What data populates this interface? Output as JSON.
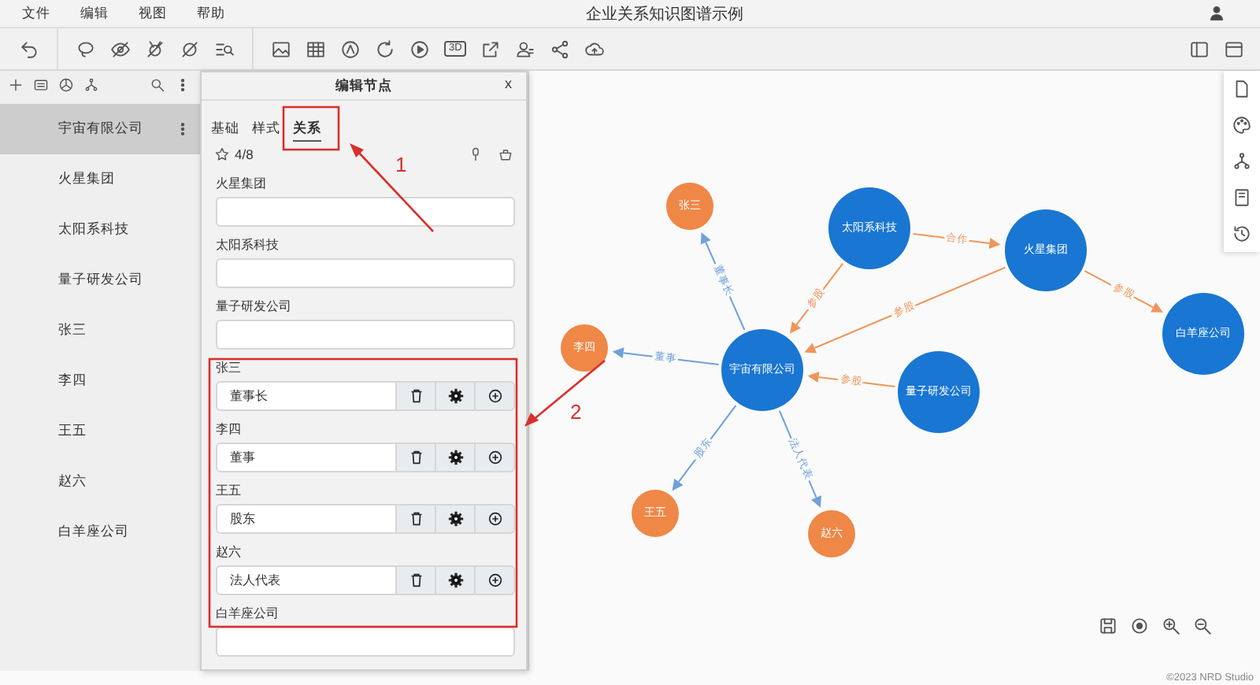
{
  "menu": [
    {
      "label": "文件"
    },
    {
      "label": "编辑"
    },
    {
      "label": "视图"
    },
    {
      "label": "帮助"
    }
  ],
  "window": {
    "title": "企业关系知识图谱示例"
  },
  "toolbar": {
    "three_d": "3D"
  },
  "sidebar": {
    "items": [
      {
        "label": "宇宙有限公司",
        "selected": true
      },
      {
        "label": "火星集团",
        "selected": false
      },
      {
        "label": "太阳系科技",
        "selected": false
      },
      {
        "label": "量子研发公司",
        "selected": false
      },
      {
        "label": "张三",
        "selected": false
      },
      {
        "label": "李四",
        "selected": false
      },
      {
        "label": "王五",
        "selected": false
      },
      {
        "label": "赵六",
        "selected": false
      },
      {
        "label": "白羊座公司",
        "selected": false
      }
    ]
  },
  "editor": {
    "title": "编辑节点",
    "close": "x",
    "tabs": [
      {
        "label": "基础",
        "selected": false
      },
      {
        "label": "样式",
        "selected": false
      },
      {
        "label": "关系",
        "selected": true
      }
    ],
    "count": "4/8",
    "relations": [
      {
        "label": "火星集团",
        "kind": "plain"
      },
      {
        "label": "太阳系科技",
        "kind": "plain"
      },
      {
        "label": "量子研发公司",
        "kind": "plain"
      },
      {
        "label": "张三",
        "kind": "linked",
        "value": "董事长"
      },
      {
        "label": "李四",
        "kind": "linked",
        "value": "董事"
      },
      {
        "label": "王五",
        "kind": "linked",
        "value": "股东"
      },
      {
        "label": "赵六",
        "kind": "linked",
        "value": "法人代表"
      },
      {
        "label": "白羊座公司",
        "kind": "plain"
      }
    ]
  },
  "graph": {
    "nodes": [
      {
        "label": "宇宙有限公司",
        "kind": "company",
        "color": "#1976d2"
      },
      {
        "label": "太阳系科技",
        "kind": "company",
        "color": "#1976d2"
      },
      {
        "label": "火星集团",
        "kind": "company",
        "color": "#1976d2"
      },
      {
        "label": "白羊座公司",
        "kind": "company",
        "color": "#1976d2"
      },
      {
        "label": "量子研发公司",
        "kind": "company",
        "color": "#1976d2"
      },
      {
        "label": "张三",
        "kind": "person",
        "color": "#ef8747"
      },
      {
        "label": "李四",
        "kind": "person",
        "color": "#ef8747"
      },
      {
        "label": "王五",
        "kind": "person",
        "color": "#ef8747"
      },
      {
        "label": "赵六",
        "kind": "person",
        "color": "#ef8747"
      }
    ],
    "edges": [
      {
        "label": "董事长",
        "color": "#6fa0dc"
      },
      {
        "label": "董事",
        "color": "#6fa0dc"
      },
      {
        "label": "股东",
        "color": "#6fa0dc"
      },
      {
        "label": "法人代表",
        "color": "#6fa0dc"
      },
      {
        "label": "合作",
        "color": "#f0965a"
      },
      {
        "label": "参股",
        "color": "#f0965a"
      },
      {
        "label": "参股",
        "color": "#f0965a"
      },
      {
        "label": "参股",
        "color": "#f0965a"
      },
      {
        "label": "参股",
        "color": "#f0965a"
      }
    ]
  },
  "annotations": [
    {
      "label": "1"
    },
    {
      "label": "2"
    }
  ],
  "footer": "©2023 NRD Studio"
}
